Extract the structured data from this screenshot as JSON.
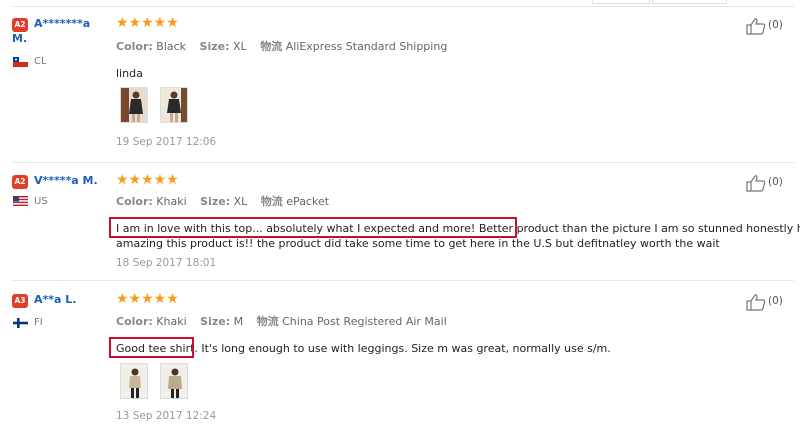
{
  "helpful_icon": "thumbs-up-icon",
  "colors": {
    "star": "#f79b1c",
    "username": "#1d5fb8",
    "badge": "#e23d28",
    "highlight": "#c8102e"
  },
  "reviews": [
    {
      "badge": "A2",
      "username_line1": "A*******a",
      "username_line2": "M.",
      "country": "CL",
      "stars": "★★★★★",
      "color_label": "Color:",
      "color_value": "Black",
      "size_label": "Size:",
      "size_value": "XL",
      "shipping_label": "物流",
      "shipping_value": "AliExpress Standard Shipping",
      "text": "linda",
      "date": "19 Sep 2017 12:06",
      "helpful_count": "(0)"
    },
    {
      "badge": "A2",
      "username_line1": "V*****a M.",
      "country": "US",
      "stars": "★★★★★",
      "color_label": "Color:",
      "color_value": "Khaki",
      "size_label": "Size:",
      "size_value": "XL",
      "shipping_label": "物流",
      "shipping_value": "ePacket",
      "text_line1": "I am in love with this top... absolutely what I expected and more! Better product than the picture I am so stunned honestly how",
      "text_line2": "amazing this product is!! the product did take some time to get here in the U.S but defitnatley worth the wait",
      "date": "18 Sep 2017 18:01",
      "helpful_count": "(0)"
    },
    {
      "badge": "A3",
      "username_line1": "A**a L.",
      "country": "FI",
      "stars": "★★★★★",
      "color_label": "Color:",
      "color_value": "Khaki",
      "size_label": "Size:",
      "size_value": "M",
      "shipping_label": "物流",
      "shipping_value": "China Post Registered Air Mail",
      "text": "Good tee shirt. It's long enough to use with leggings. Size m was great, normally use s/m.",
      "date": "13 Sep 2017 12:24",
      "helpful_count": "(0)"
    }
  ]
}
